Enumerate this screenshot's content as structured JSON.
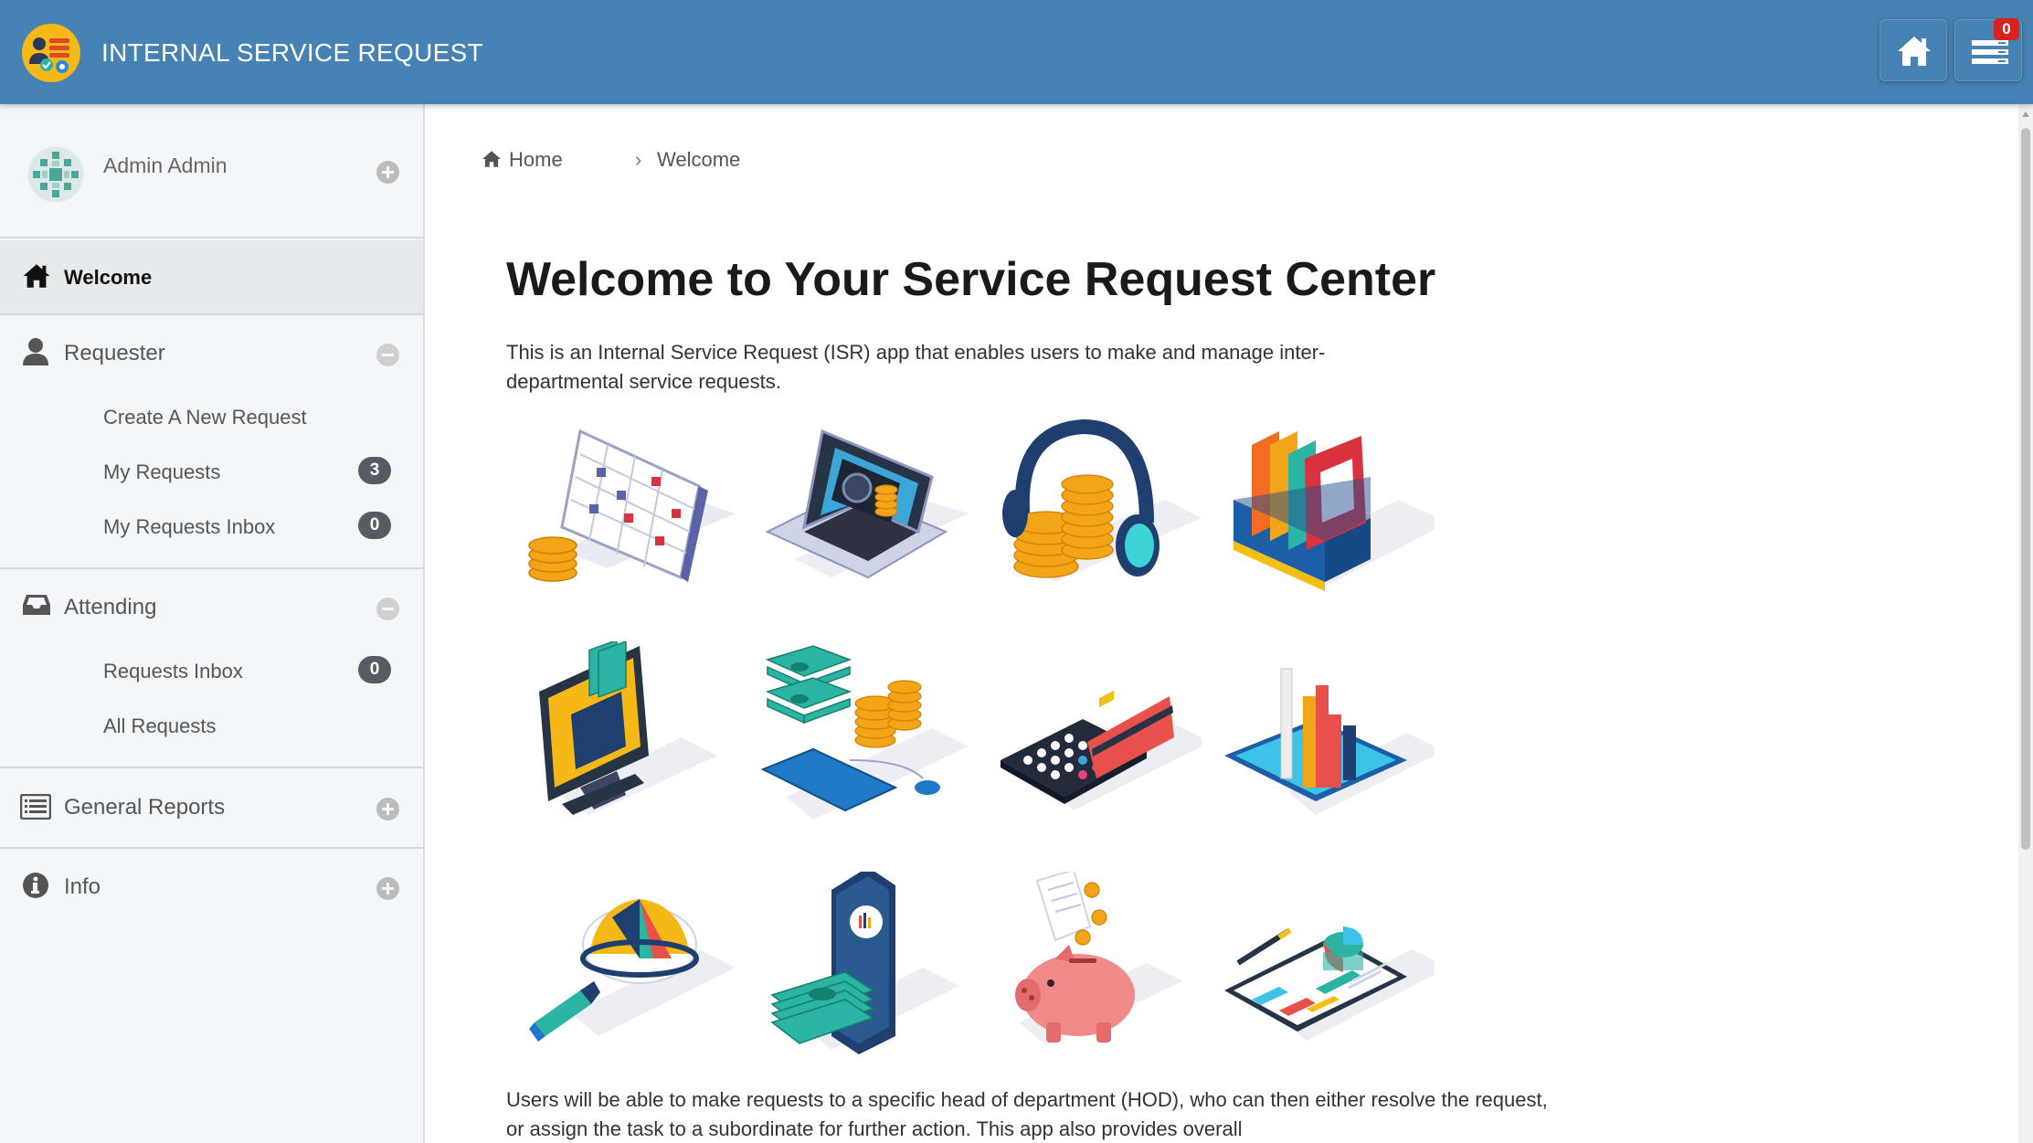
{
  "header": {
    "app_title": "INTERNAL SERVICE REQUEST",
    "logo_icon": "service-request-logo-icon",
    "home_icon": "home-icon",
    "menu_icon": "list-icon",
    "notification_count": "0",
    "colors": {
      "bar": "#4682b4",
      "logo": "#f6b817",
      "badge": "#d9211e"
    }
  },
  "sidebar": {
    "profile": {
      "name": "Admin Admin",
      "avatar_icon": "avatar-icon",
      "toggle_icon": "plus-circle-icon"
    },
    "welcome": {
      "label": "Welcome",
      "icon": "home-icon"
    },
    "requester": {
      "label": "Requester",
      "icon": "user-icon",
      "toggle_icon": "minus-circle-icon",
      "items": [
        {
          "label": "Create A New Request"
        },
        {
          "label": "My Requests",
          "count": "3"
        },
        {
          "label": "My Requests Inbox",
          "count": "0"
        }
      ]
    },
    "attending": {
      "label": "Attending",
      "icon": "inbox-icon",
      "toggle_icon": "minus-circle-icon",
      "items": [
        {
          "label": "Requests Inbox",
          "count": "0"
        },
        {
          "label": "All Requests"
        }
      ]
    },
    "general_reports": {
      "label": "General Reports",
      "icon": "report-list-icon",
      "toggle_icon": "plus-circle-icon"
    },
    "info": {
      "label": "Info",
      "icon": "info-icon",
      "toggle_icon": "plus-circle-icon"
    }
  },
  "main": {
    "breadcrumb": {
      "home": "Home",
      "separator": "›",
      "current": "Welcome"
    },
    "title": "Welcome to Your Service Request Center",
    "intro": "This is an Internal Service Request (ISR) app that enables users to make and manage inter-departmental service requests.",
    "illustrations": [
      "calendar-coins-icon",
      "laptop-vault-icon",
      "headphones-coins-icon",
      "binders-box-icon",
      "monitor-wallet-icon",
      "cash-keyboard-icon",
      "calculator-card-icon",
      "bar-chart-tablet-icon",
      "magnifier-pie-icon",
      "phone-cash-icon",
      "piggy-bank-icon",
      "clipboard-charts-icon"
    ],
    "outro": "Users will be able to make requests to a specific head of department (HOD), who can then either resolve the request, or assign the task to a subordinate for further action. This app also provides overall"
  }
}
